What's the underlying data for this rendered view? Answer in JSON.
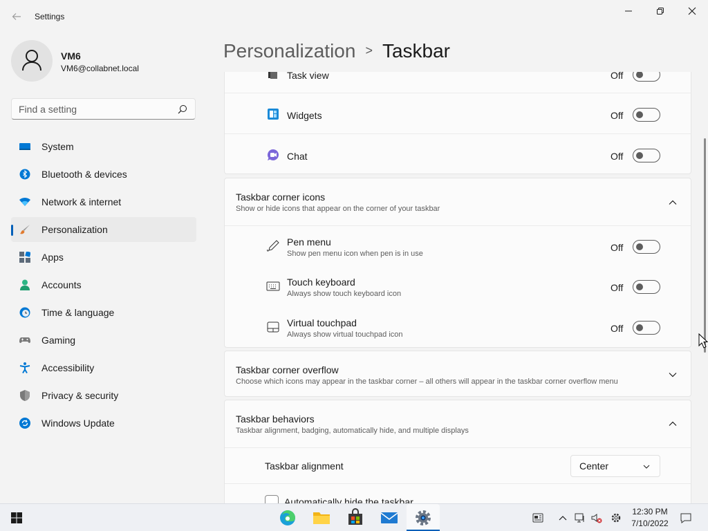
{
  "window": {
    "title": "Settings"
  },
  "profile": {
    "name": "VM6",
    "email": "VM6@collabnet.local"
  },
  "search": {
    "placeholder": "Find a setting"
  },
  "sidebar": {
    "items": [
      {
        "label": "System",
        "icon": "system-icon"
      },
      {
        "label": "Bluetooth & devices",
        "icon": "bluetooth-icon"
      },
      {
        "label": "Network & internet",
        "icon": "wifi-icon"
      },
      {
        "label": "Personalization",
        "icon": "brush-icon",
        "active": true
      },
      {
        "label": "Apps",
        "icon": "apps-icon"
      },
      {
        "label": "Accounts",
        "icon": "accounts-icon"
      },
      {
        "label": "Time & language",
        "icon": "clock-globe-icon"
      },
      {
        "label": "Gaming",
        "icon": "gamepad-icon"
      },
      {
        "label": "Accessibility",
        "icon": "accessibility-icon"
      },
      {
        "label": "Privacy & security",
        "icon": "shield-icon"
      },
      {
        "label": "Windows Update",
        "icon": "update-icon"
      }
    ]
  },
  "breadcrumb": {
    "parent": "Personalization",
    "separator": ">",
    "current": "Taskbar"
  },
  "taskbar_items": {
    "task_view": {
      "label": "Task view",
      "state": "Off"
    },
    "widgets": {
      "label": "Widgets",
      "state": "Off"
    },
    "chat": {
      "label": "Chat",
      "state": "Off"
    }
  },
  "corner_icons": {
    "title": "Taskbar corner icons",
    "subtitle": "Show or hide icons that appear on the corner of your taskbar",
    "items": {
      "pen_menu": {
        "label": "Pen menu",
        "desc": "Show pen menu icon when pen is in use",
        "state": "Off"
      },
      "touch_keyboard": {
        "label": "Touch keyboard",
        "desc": "Always show touch keyboard icon",
        "state": "Off"
      },
      "virtual_touchpad": {
        "label": "Virtual touchpad",
        "desc": "Always show virtual touchpad icon",
        "state": "Off"
      }
    }
  },
  "corner_overflow": {
    "title": "Taskbar corner overflow",
    "subtitle": "Choose which icons may appear in the taskbar corner – all others will appear in the taskbar corner overflow menu"
  },
  "behaviors": {
    "title": "Taskbar behaviors",
    "subtitle": "Taskbar alignment, badging, automatically hide, and multiple displays",
    "alignment_label": "Taskbar alignment",
    "alignment_value": "Center",
    "autohide_label": "Automatically hide the taskbar"
  },
  "clock": {
    "time": "12:30 PM",
    "date": "7/10/2022"
  },
  "colors": {
    "accent": "#005fb8",
    "background": "#f3f3f3",
    "card": "#fbfbfb"
  }
}
